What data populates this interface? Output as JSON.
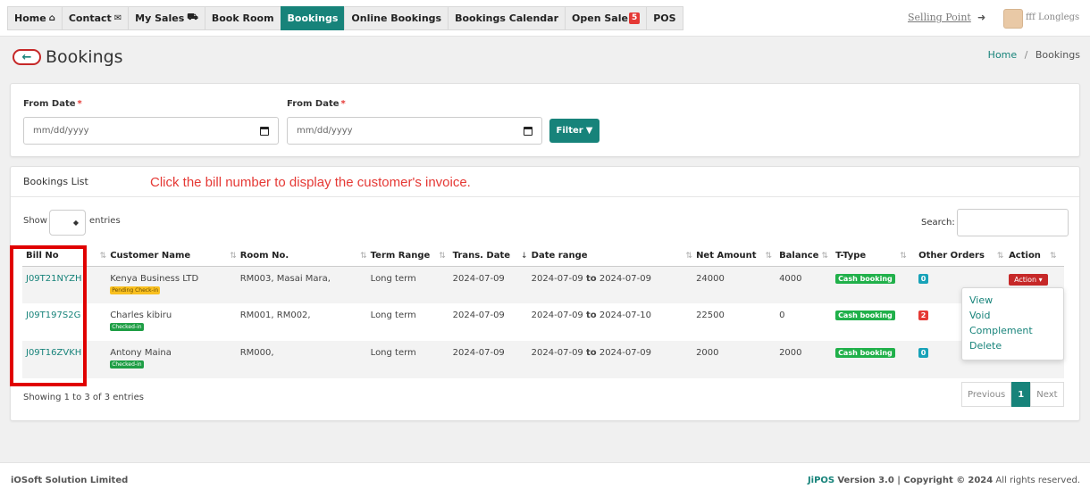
{
  "nav": {
    "items": [
      {
        "label": "Home",
        "icon": "home-icon"
      },
      {
        "label": "Contact",
        "icon": "envelope-icon"
      },
      {
        "label": "My Sales",
        "icon": "cart-icon"
      },
      {
        "label": "Book Room"
      },
      {
        "label": "Bookings",
        "active": true
      },
      {
        "label": "Online Bookings"
      },
      {
        "label": "Bookings Calendar"
      },
      {
        "label": "Open Sale",
        "badge": "5"
      },
      {
        "label": "POS"
      }
    ],
    "selling_point": "Selling Point",
    "user_name": "fff Longlegs"
  },
  "page": {
    "title": "Bookings",
    "breadcrumb_home": "Home",
    "breadcrumb_sep": "/",
    "breadcrumb_current": "Bookings"
  },
  "filter": {
    "from_label_1": "From Date",
    "from_label_2": "From Date",
    "required_mark": "*",
    "date_placeholder_1": "mm/dd/yyyy",
    "date_placeholder_2": "mm/dd/yyyy",
    "button_label": "Filter"
  },
  "list": {
    "title": "Bookings List",
    "annotation": "Click the bill number to display the customer's invoice.",
    "show_label": "Show",
    "entries_label": "entries",
    "search_label": "Search:",
    "columns": [
      "Bill No",
      "Customer Name",
      "Room No.",
      "Term Range",
      "Trans. Date",
      "Date range",
      "Net Amount",
      "Balance",
      "T-Type",
      "Other Orders",
      "Action"
    ],
    "date_to": "to",
    "rows": [
      {
        "bill": "J09T21NYZH",
        "customer": "Kenya Business LTD",
        "status": "Pending Check-in",
        "room": "RM003, Masai Mara,",
        "term": "Long term",
        "trans": "2024-07-09",
        "from": "2024-07-09",
        "to": "2024-07-09",
        "net": "24000",
        "balance": "4000",
        "ttype": "Cash booking",
        "orders": "0"
      },
      {
        "bill": "J09T197S2G",
        "customer": "Charles kibiru",
        "status": "Checked-in",
        "room": "RM001, RM002,",
        "term": "Long term",
        "trans": "2024-07-09",
        "from": "2024-07-09",
        "to": "2024-07-10",
        "net": "22500",
        "balance": "0",
        "ttype": "Cash booking",
        "orders": "2"
      },
      {
        "bill": "J09T16ZVKH",
        "customer": "Antony Maina",
        "status": "Checked-in",
        "room": "RM000,",
        "term": "Long term",
        "trans": "2024-07-09",
        "from": "2024-07-09",
        "to": "2024-07-09",
        "net": "2000",
        "balance": "2000",
        "ttype": "Cash booking",
        "orders": "0"
      }
    ],
    "action_label": "Action",
    "action_menu": [
      "View",
      "Void",
      "Complement",
      "Delete"
    ],
    "showing_text": "Showing 1 to 3 of 3 entries",
    "pager": {
      "prev": "Previous",
      "current": "1",
      "next": "Next"
    }
  },
  "footer": {
    "company": "iOSoft Solution Limited",
    "brand": "JiPOS",
    "version": "Version 3.0 | Copyright ©",
    "year": "2024",
    "rights": "All rights reserved."
  },
  "colors": {
    "accent": "#17837a",
    "danger": "#c62828",
    "annotation": "#e53935"
  }
}
